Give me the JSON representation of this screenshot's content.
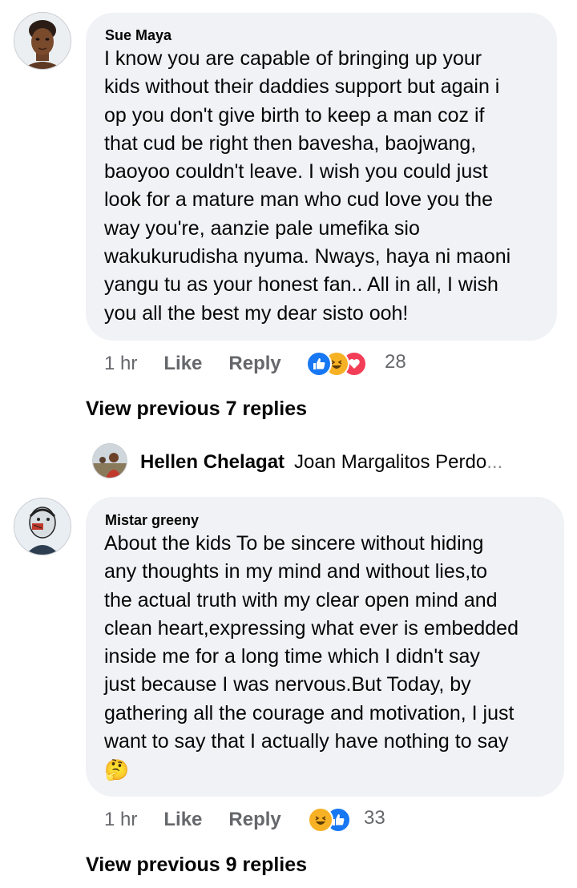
{
  "comments": [
    {
      "author": "Sue Maya",
      "lines": [
        "I know you are capable of bringing up your",
        "kids without their daddies support but again i",
        "op you don't give birth to keep a man coz if",
        "that cud be right then bavesha, baojwang,",
        "baoyoo couldn't leave. I wish you could just",
        "look for a mature man who cud love you the",
        "way you're, aanzie pale umefika sio",
        "wakukurudisha nyuma. Nways, haya ni maoni",
        "yangu tu as your honest fan.. All in all, I wish",
        "you all the best my dear sisto ooh!"
      ],
      "time": "1 hr",
      "like_label": "Like",
      "reply_label": "Reply",
      "reactions": [
        "like-reaction-icon",
        "haha-reaction-icon",
        "love-reaction-icon"
      ],
      "reaction_count": "28",
      "view_previous": "View previous 7 replies",
      "latest_reply": {
        "author": "Hellen Chelagat",
        "text": "Joan Margalitos Perdo",
        "ellipsis": "..."
      }
    },
    {
      "author": "Mistar greeny",
      "lines": [
        "About the kids To be sincere without hiding",
        "any thoughts in my mind and without lies,to",
        "the actual truth with my clear open mind and",
        "clean heart,expressing what ever is embedded",
        "inside me for a long time which I didn't say",
        "just because I was nervous.But Today, by",
        "gathering all the courage and motivation, I just",
        "want to say that I actually have nothing to say"
      ],
      "emoji": "🤔",
      "time": "1 hr",
      "like_label": "Like",
      "reply_label": "Reply",
      "reactions": [
        "haha-reaction-icon",
        "like-reaction-icon"
      ],
      "reaction_count": "33",
      "view_previous": "View previous 9 replies"
    }
  ],
  "colors": {
    "bubble": "#f0f2f5",
    "like_blue": "#1877f2",
    "love_red": "#f33e58",
    "haha_yellow": "#f7b125",
    "secondary_text": "#65676b"
  }
}
